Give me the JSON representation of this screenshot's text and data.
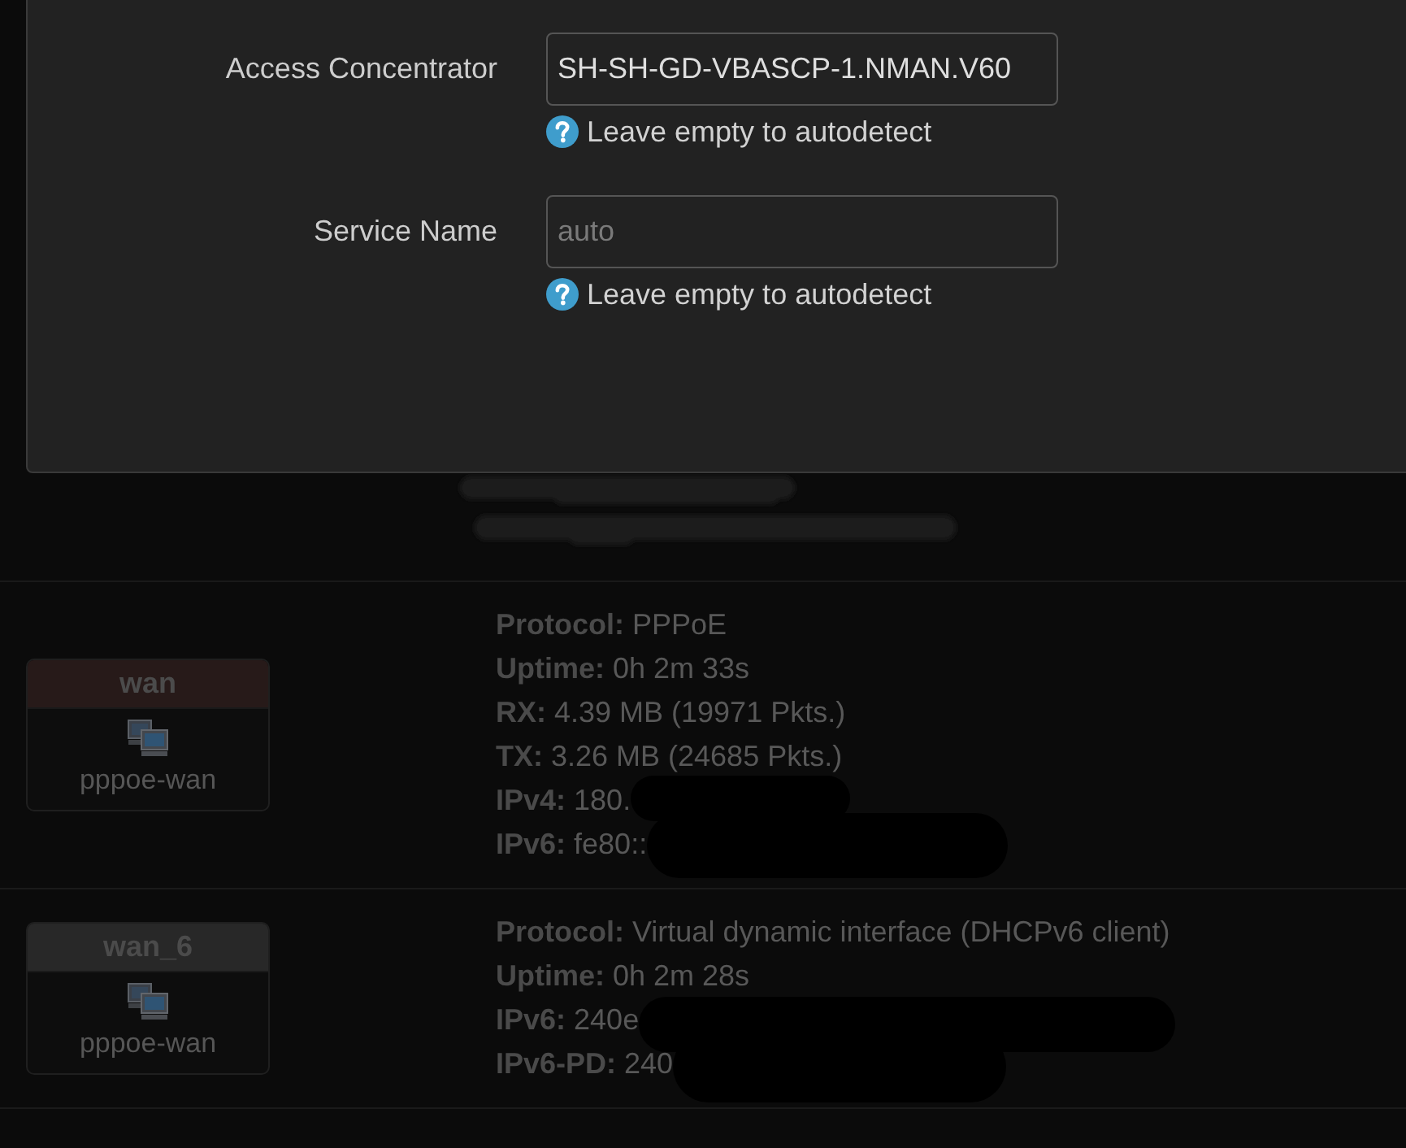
{
  "dialog": {
    "fields": [
      {
        "label": "Access Concentrator",
        "value": "SH-SH-GD-VBASCP-1.NMAN.V60",
        "help": "Leave empty to autodetect"
      },
      {
        "label": "Service Name",
        "placeholder": "auto",
        "help": "Leave empty to autodetect"
      }
    ]
  },
  "interfaces": [
    {
      "name": "wan",
      "color": "#271a19",
      "device": "pppoe-wan",
      "details": [
        {
          "label": "Protocol:",
          "value": "PPPoE",
          "redacted": false
        },
        {
          "label": "Uptime:",
          "value": "0h 2m 33s",
          "redacted": false
        },
        {
          "label": "RX:",
          "value": "4.39 MB (19971 Pkts.)",
          "redacted": false
        },
        {
          "label": "TX:",
          "value": "3.26 MB (24685 Pkts.)",
          "redacted": false
        },
        {
          "label": "IPv4:",
          "value": "180.",
          "redacted": true
        },
        {
          "label": "IPv6:",
          "value": "fe80::",
          "redacted": true
        }
      ]
    },
    {
      "name": "wan_6",
      "color": "#282828",
      "device": "pppoe-wan",
      "details": [
        {
          "label": "Protocol:",
          "value": "Virtual dynamic interface (DHCPv6 client)",
          "redacted": false
        },
        {
          "label": "Uptime:",
          "value": "0h 2m 28s",
          "redacted": false
        },
        {
          "label": "IPv6:",
          "value": "240e",
          "redacted": true
        },
        {
          "label": "IPv6-PD:",
          "value": "240",
          "redacted": true
        }
      ]
    }
  ]
}
